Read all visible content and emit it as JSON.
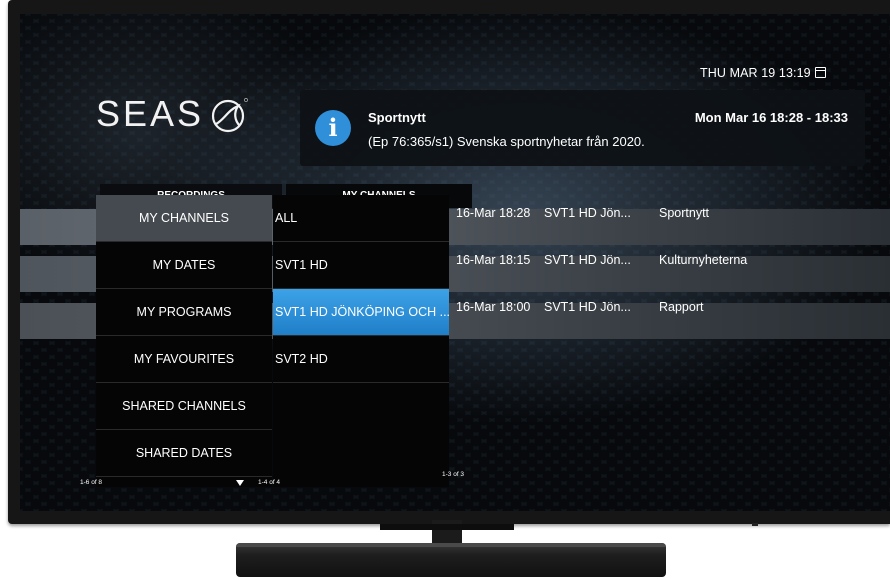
{
  "clock": {
    "text": "THU MAR 19 13:19"
  },
  "logo": {
    "text": "SEAS"
  },
  "info": {
    "icon": "info-icon",
    "title": "Sportnytt",
    "description": "(Ep 76:365/s1) Svenska sportnyhetar från 2020.",
    "time": "Mon Mar 16 18:28 - 18:33",
    "accent": "#2f8fd8"
  },
  "tabs": [
    {
      "label": "RECORDINGS"
    },
    {
      "label": "MY CHANNELS"
    }
  ],
  "categories": {
    "items": [
      {
        "label": "MY CHANNELS",
        "selected": true
      },
      {
        "label": "MY DATES"
      },
      {
        "label": "MY PROGRAMS"
      },
      {
        "label": "MY FAVOURITES"
      },
      {
        "label": "SHARED CHANNELS"
      },
      {
        "label": "SHARED DATES"
      }
    ],
    "pagination": "1-6 of 8"
  },
  "channels": {
    "items": [
      {
        "label": "ALL"
      },
      {
        "label": "SVT1 HD"
      },
      {
        "label": "SVT1 HD JÖNKÖPING OCH ...",
        "selected": true
      },
      {
        "label": "SVT2 HD"
      }
    ],
    "pagination": "1-4 of 4",
    "selected_color": "#2a8bd6"
  },
  "recordings": {
    "rows": [
      {
        "date": "16-Mar 18:28",
        "channel": "SVT1 HD Jön...",
        "title": "Sportnytt"
      },
      {
        "date": "16-Mar 18:15",
        "channel": "SVT1 HD Jön...",
        "title": "Kulturnyheterna"
      },
      {
        "date": "16-Mar 18:00",
        "channel": "SVT1 HD Jön...",
        "title": "Rapport"
      }
    ],
    "pagination": "1-3 of 3"
  }
}
